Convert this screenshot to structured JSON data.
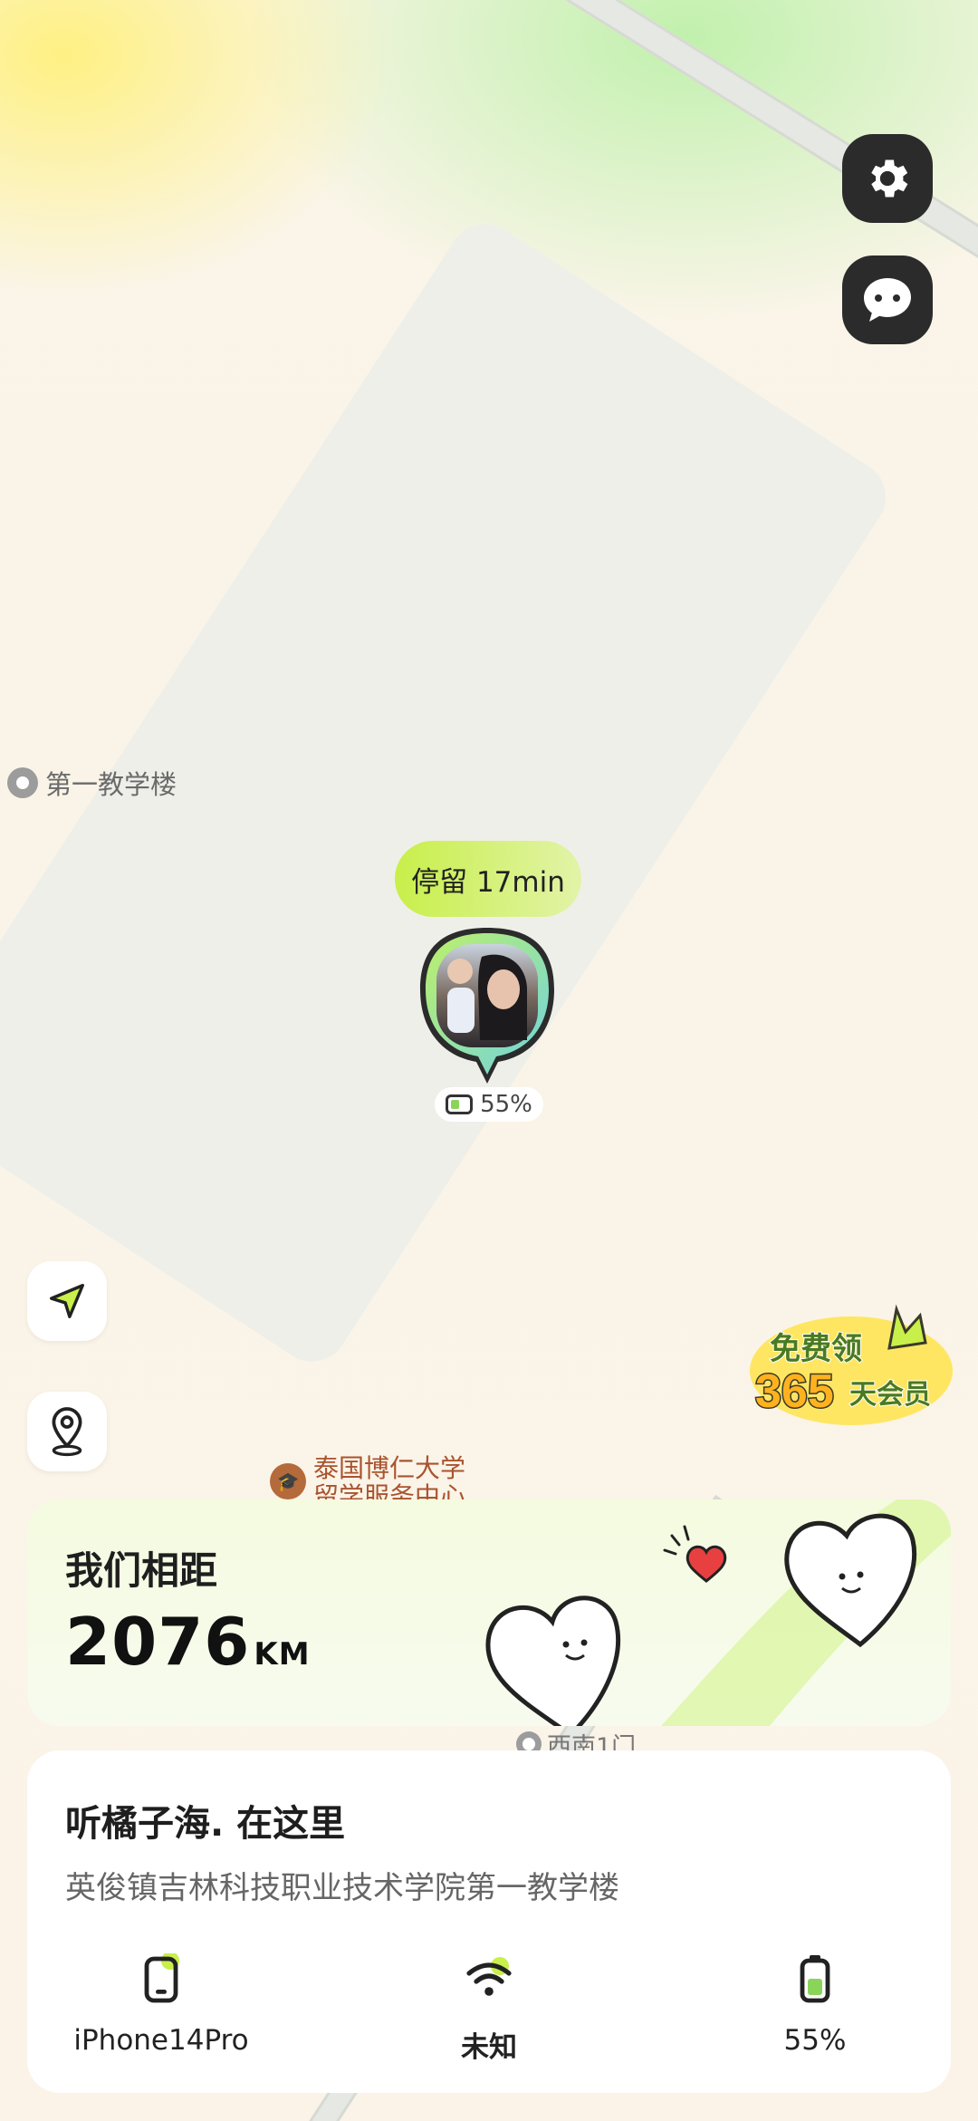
{
  "map": {
    "poi_label": "第一教学楼",
    "school_label_line1": "泰国博仁大学",
    "school_label_line2": "留学服务中心",
    "gate_label": "西南1门"
  },
  "header": {
    "settings_icon": "gear-icon",
    "chat_icon": "chat-bubble-icon"
  },
  "marker": {
    "stay_label": "停留 17min",
    "battery": "55%"
  },
  "side": {
    "locate_icon": "navigation-arrow-icon",
    "pin_icon": "location-pin-icon"
  },
  "promo": {
    "line1": "免费领",
    "number": "365",
    "line2": "天会员"
  },
  "distance": {
    "title": "我们相距",
    "value": "2076",
    "unit": "KM"
  },
  "info": {
    "title": "听橘子海. 在这里",
    "address": "英俊镇吉林科技职业技术学院第一教学楼",
    "device": "iPhone14Pro",
    "wifi": "未知",
    "battery": "55%"
  },
  "colors": {
    "accent": "#c8ef4a",
    "dark": "#2b2b2b"
  }
}
